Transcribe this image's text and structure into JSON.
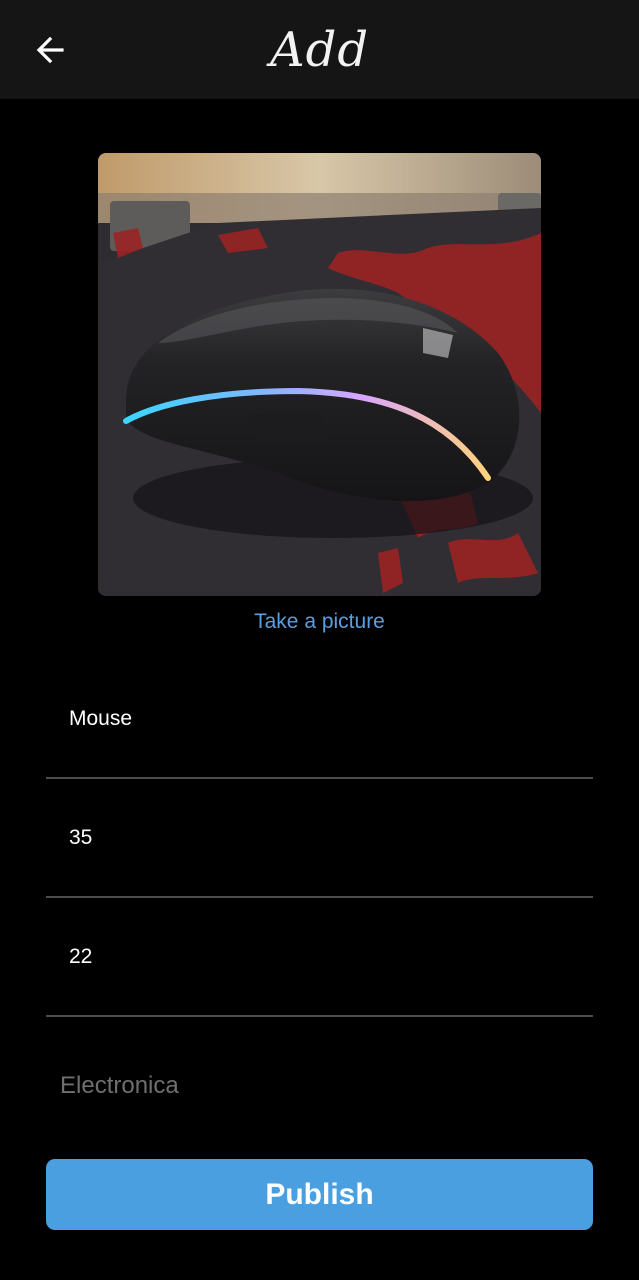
{
  "app_bar": {
    "title": "Add",
    "back_icon": "arrow-left-icon",
    "background": "#151515"
  },
  "photo": {
    "subject": "mouse-photo"
  },
  "take_picture_label": "Take a picture",
  "form": {
    "name_value": "Mouse",
    "price_value": "35",
    "quantity_value": "22",
    "category_placeholder": "Electronica",
    "category_value": ""
  },
  "publish_label": "Publish",
  "colors": {
    "accent": "#4a9fe0",
    "link": "#5b9fe0",
    "divider": "#4d4d4d",
    "placeholder": "#6f6f6f"
  }
}
